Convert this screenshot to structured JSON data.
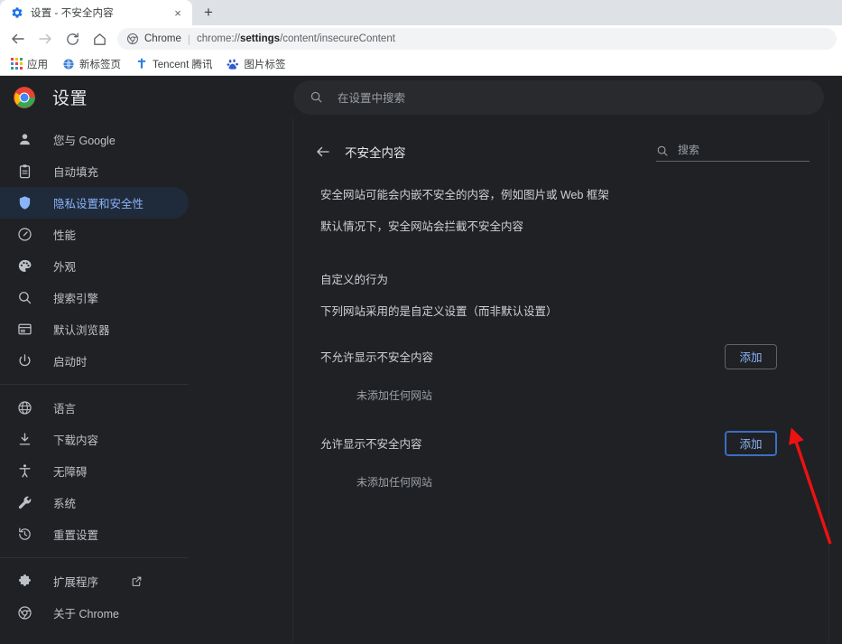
{
  "browser": {
    "tab": {
      "title": "设置 - 不安全内容",
      "favicon_name": "settings-gear-icon",
      "close_label": "×"
    },
    "new_tab_label": "+",
    "nav": {
      "back_label": "←",
      "forward_label": "→",
      "reload_label": "⟳",
      "home_label": "⌂"
    },
    "omnibox": {
      "chip_label": "Chrome",
      "separator": "|",
      "url_prefix": "chrome://",
      "url_bold": "settings",
      "url_suffix": "/content/insecureContent"
    },
    "bookmarks": [
      {
        "label": "应用",
        "icon": "apps-grid-icon"
      },
      {
        "label": "新标签页",
        "icon": "globe-icon"
      },
      {
        "label": "Tencent 腾讯",
        "icon": "tencent-t-icon"
      },
      {
        "label": "图片标签",
        "icon": "baidu-paw-icon"
      }
    ]
  },
  "settings": {
    "brand_title": "设置",
    "brand_icon": "chrome-logo-icon",
    "top_search": {
      "placeholder": "在设置中搜索",
      "icon": "search-icon"
    },
    "sidebar": {
      "groups": [
        {
          "items": [
            {
              "label": "您与 Google",
              "icon": "person-icon",
              "active": false
            },
            {
              "label": "自动填充",
              "icon": "clipboard-icon",
              "active": false
            },
            {
              "label": "隐私设置和安全性",
              "icon": "shield-icon",
              "active": true
            },
            {
              "label": "性能",
              "icon": "speedometer-icon",
              "active": false
            },
            {
              "label": "外观",
              "icon": "palette-icon",
              "active": false
            },
            {
              "label": "搜索引擎",
              "icon": "search-icon",
              "active": false
            },
            {
              "label": "默认浏览器",
              "icon": "browser-window-icon",
              "active": false
            },
            {
              "label": "启动时",
              "icon": "power-icon",
              "active": false
            }
          ]
        },
        {
          "items": [
            {
              "label": "语言",
              "icon": "globe-icon",
              "active": false
            },
            {
              "label": "下载内容",
              "icon": "download-icon",
              "active": false
            },
            {
              "label": "无障碍",
              "icon": "accessibility-icon",
              "active": false
            },
            {
              "label": "系统",
              "icon": "wrench-icon",
              "active": false
            },
            {
              "label": "重置设置",
              "icon": "history-restore-icon",
              "active": false
            }
          ]
        },
        {
          "items": [
            {
              "label": "扩展程序",
              "icon": "puzzle-icon",
              "active": false,
              "external_icon": "open-in-new-icon"
            },
            {
              "label": "关于 Chrome",
              "icon": "chrome-outline-icon",
              "active": false
            }
          ]
        }
      ]
    },
    "content": {
      "back_icon": "arrow-back-icon",
      "title": "不安全内容",
      "inline_search": {
        "placeholder": "搜索",
        "icon": "search-icon"
      },
      "descriptions": [
        "安全网站可能会内嵌不安全的内容，例如图片或 Web 框架",
        "默认情况下，安全网站会拦截不安全内容"
      ],
      "custom_behavior_heading": "自定义的行为",
      "custom_behavior_sub": "下列网站采用的是自定义设置（而非默认设置）",
      "permission_sections": [
        {
          "label": "不允许显示不安全内容",
          "button_label": "添加",
          "focused": false,
          "empty_note": "未添加任何网站"
        },
        {
          "label": "允许显示不安全内容",
          "button_label": "添加",
          "focused": true,
          "empty_note": "未添加任何网站"
        }
      ]
    }
  },
  "annotation": {
    "arrow_color": "#ee1111",
    "arrow_name": "red-pointer-arrow"
  },
  "colors": {
    "page_bg": "#202124",
    "accent_blue": "#8ab4f8",
    "focus_blue": "#3b6fc4",
    "chrome_light": "#dee1e6"
  }
}
